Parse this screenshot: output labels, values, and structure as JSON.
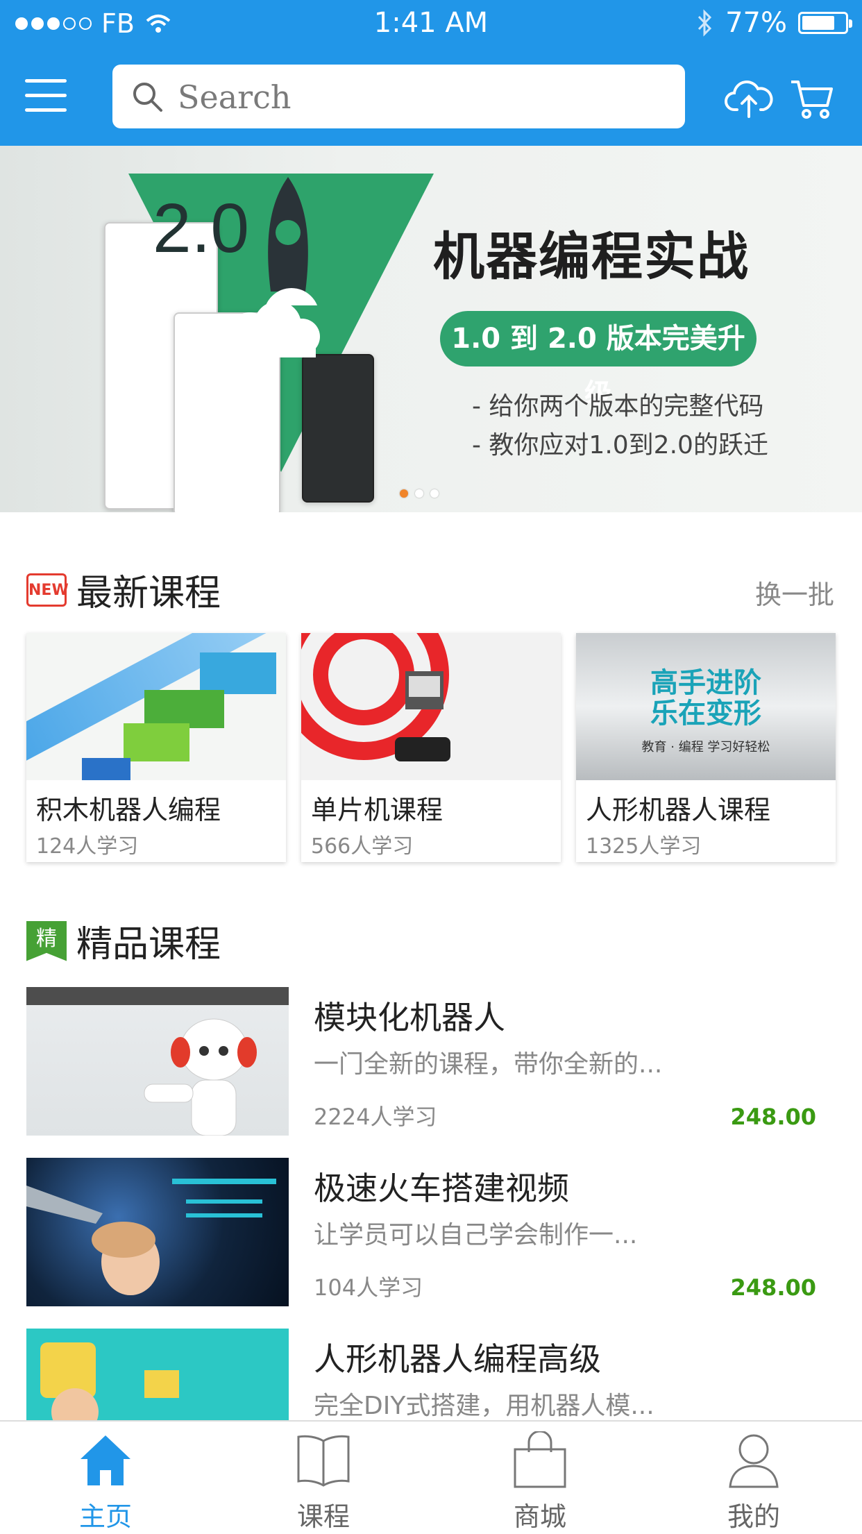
{
  "status_bar": {
    "carrier": "FB",
    "time": "1:41 AM",
    "battery": "77%",
    "battery_level": 0.77
  },
  "header": {
    "search_placeholder": "Search"
  },
  "banner": {
    "version": "2.0",
    "headline": "机器编程实战",
    "pill": "1.0 到 2.0 版本完美升级",
    "bullets": [
      "- 给你两个版本的完整代码",
      "- 教你应对1.0到2.0的跃迁"
    ],
    "slides": 3,
    "active_slide": 1
  },
  "new_courses": {
    "badge": "NEW",
    "title": "最新课程",
    "refresh": "换一批",
    "items": [
      {
        "name": "积木机器人编程",
        "count": "124人学习"
      },
      {
        "name": "单片机课程",
        "count": "566人学习"
      },
      {
        "name": "人形机器人课程",
        "count": "1325人学习",
        "thumb_lines": [
          "高手进阶",
          "乐在变形"
        ],
        "thumb_sub": "教育 · 编程  学习好轻松"
      }
    ]
  },
  "featured": {
    "badge": "精",
    "title": "精品课程",
    "items": [
      {
        "title": "模块化机器人",
        "desc": "一门全新的课程，带你全新的...",
        "count": "2224人学习",
        "price": "248.00"
      },
      {
        "title": "极速火车搭建视频",
        "desc": "让学员可以自己学会制作一...",
        "count": "104人学习",
        "price": "248.00"
      },
      {
        "title": "人形机器人编程高级",
        "desc": "完全DIY式搭建，用机器人模...",
        "count": "",
        "price": ""
      }
    ]
  },
  "tabbar": {
    "tabs": [
      {
        "label": "主页",
        "icon": "home-icon",
        "active": true
      },
      {
        "label": "课程",
        "icon": "book-icon",
        "active": false
      },
      {
        "label": "商城",
        "icon": "bag-icon",
        "active": false
      },
      {
        "label": "我的",
        "icon": "user-icon",
        "active": false
      }
    ]
  }
}
